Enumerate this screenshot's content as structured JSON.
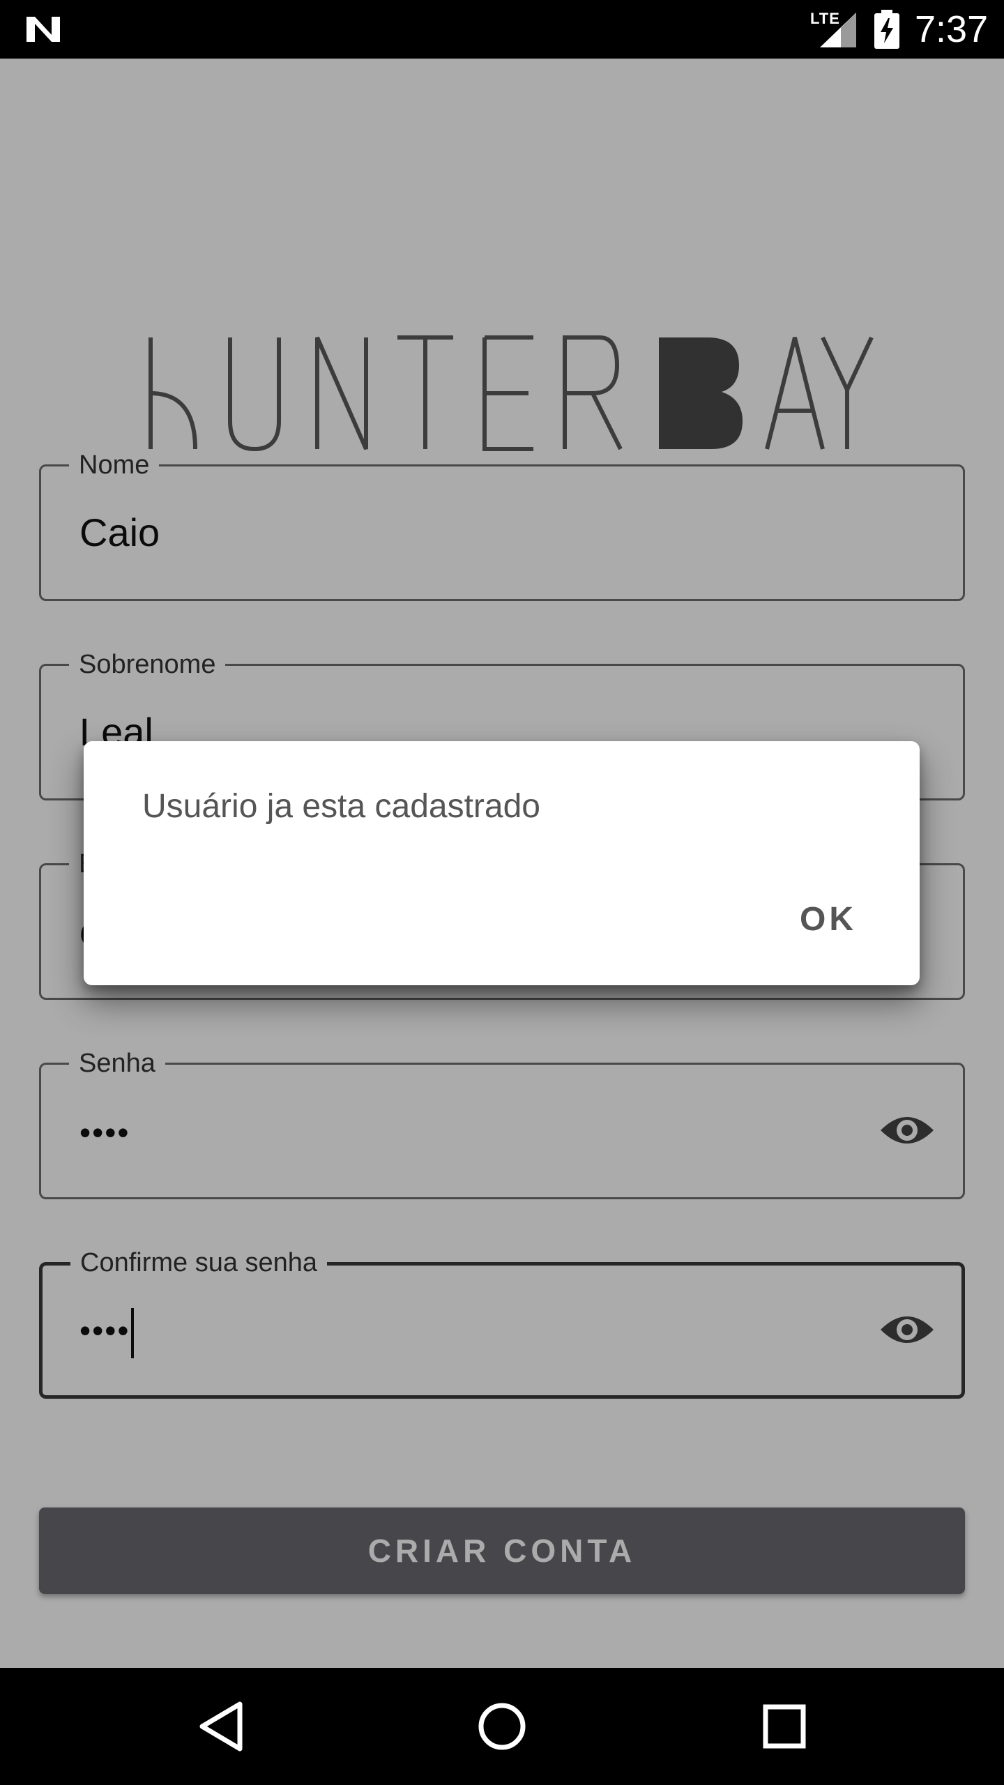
{
  "status_bar": {
    "network": "LTE",
    "time": "7:37",
    "icons": [
      "n-notification-icon",
      "signal-icon",
      "battery-charging-icon"
    ]
  },
  "app": {
    "logo_text": "HUNTER BAY",
    "fields": {
      "nome": {
        "label": "Nome",
        "value": "Caio"
      },
      "sobrenome": {
        "label": "Sobrenome",
        "value": "Leal"
      },
      "email": {
        "label": "E",
        "value": "c"
      },
      "senha": {
        "label": "Senha",
        "value": "••••"
      },
      "confirme": {
        "label": "Confirme sua senha",
        "value": "••••"
      }
    },
    "create_button": "CRIAR CONTA"
  },
  "dialog": {
    "message": "Usuário ja esta cadastrado",
    "ok_label": "OK"
  },
  "nav_bar": {
    "icons": [
      "back-icon",
      "home-icon",
      "recents-icon"
    ]
  },
  "colors": {
    "field_border": "#6e6e6e",
    "button_bg": "#6b6970",
    "logo_dark": "#4a4a4a"
  }
}
